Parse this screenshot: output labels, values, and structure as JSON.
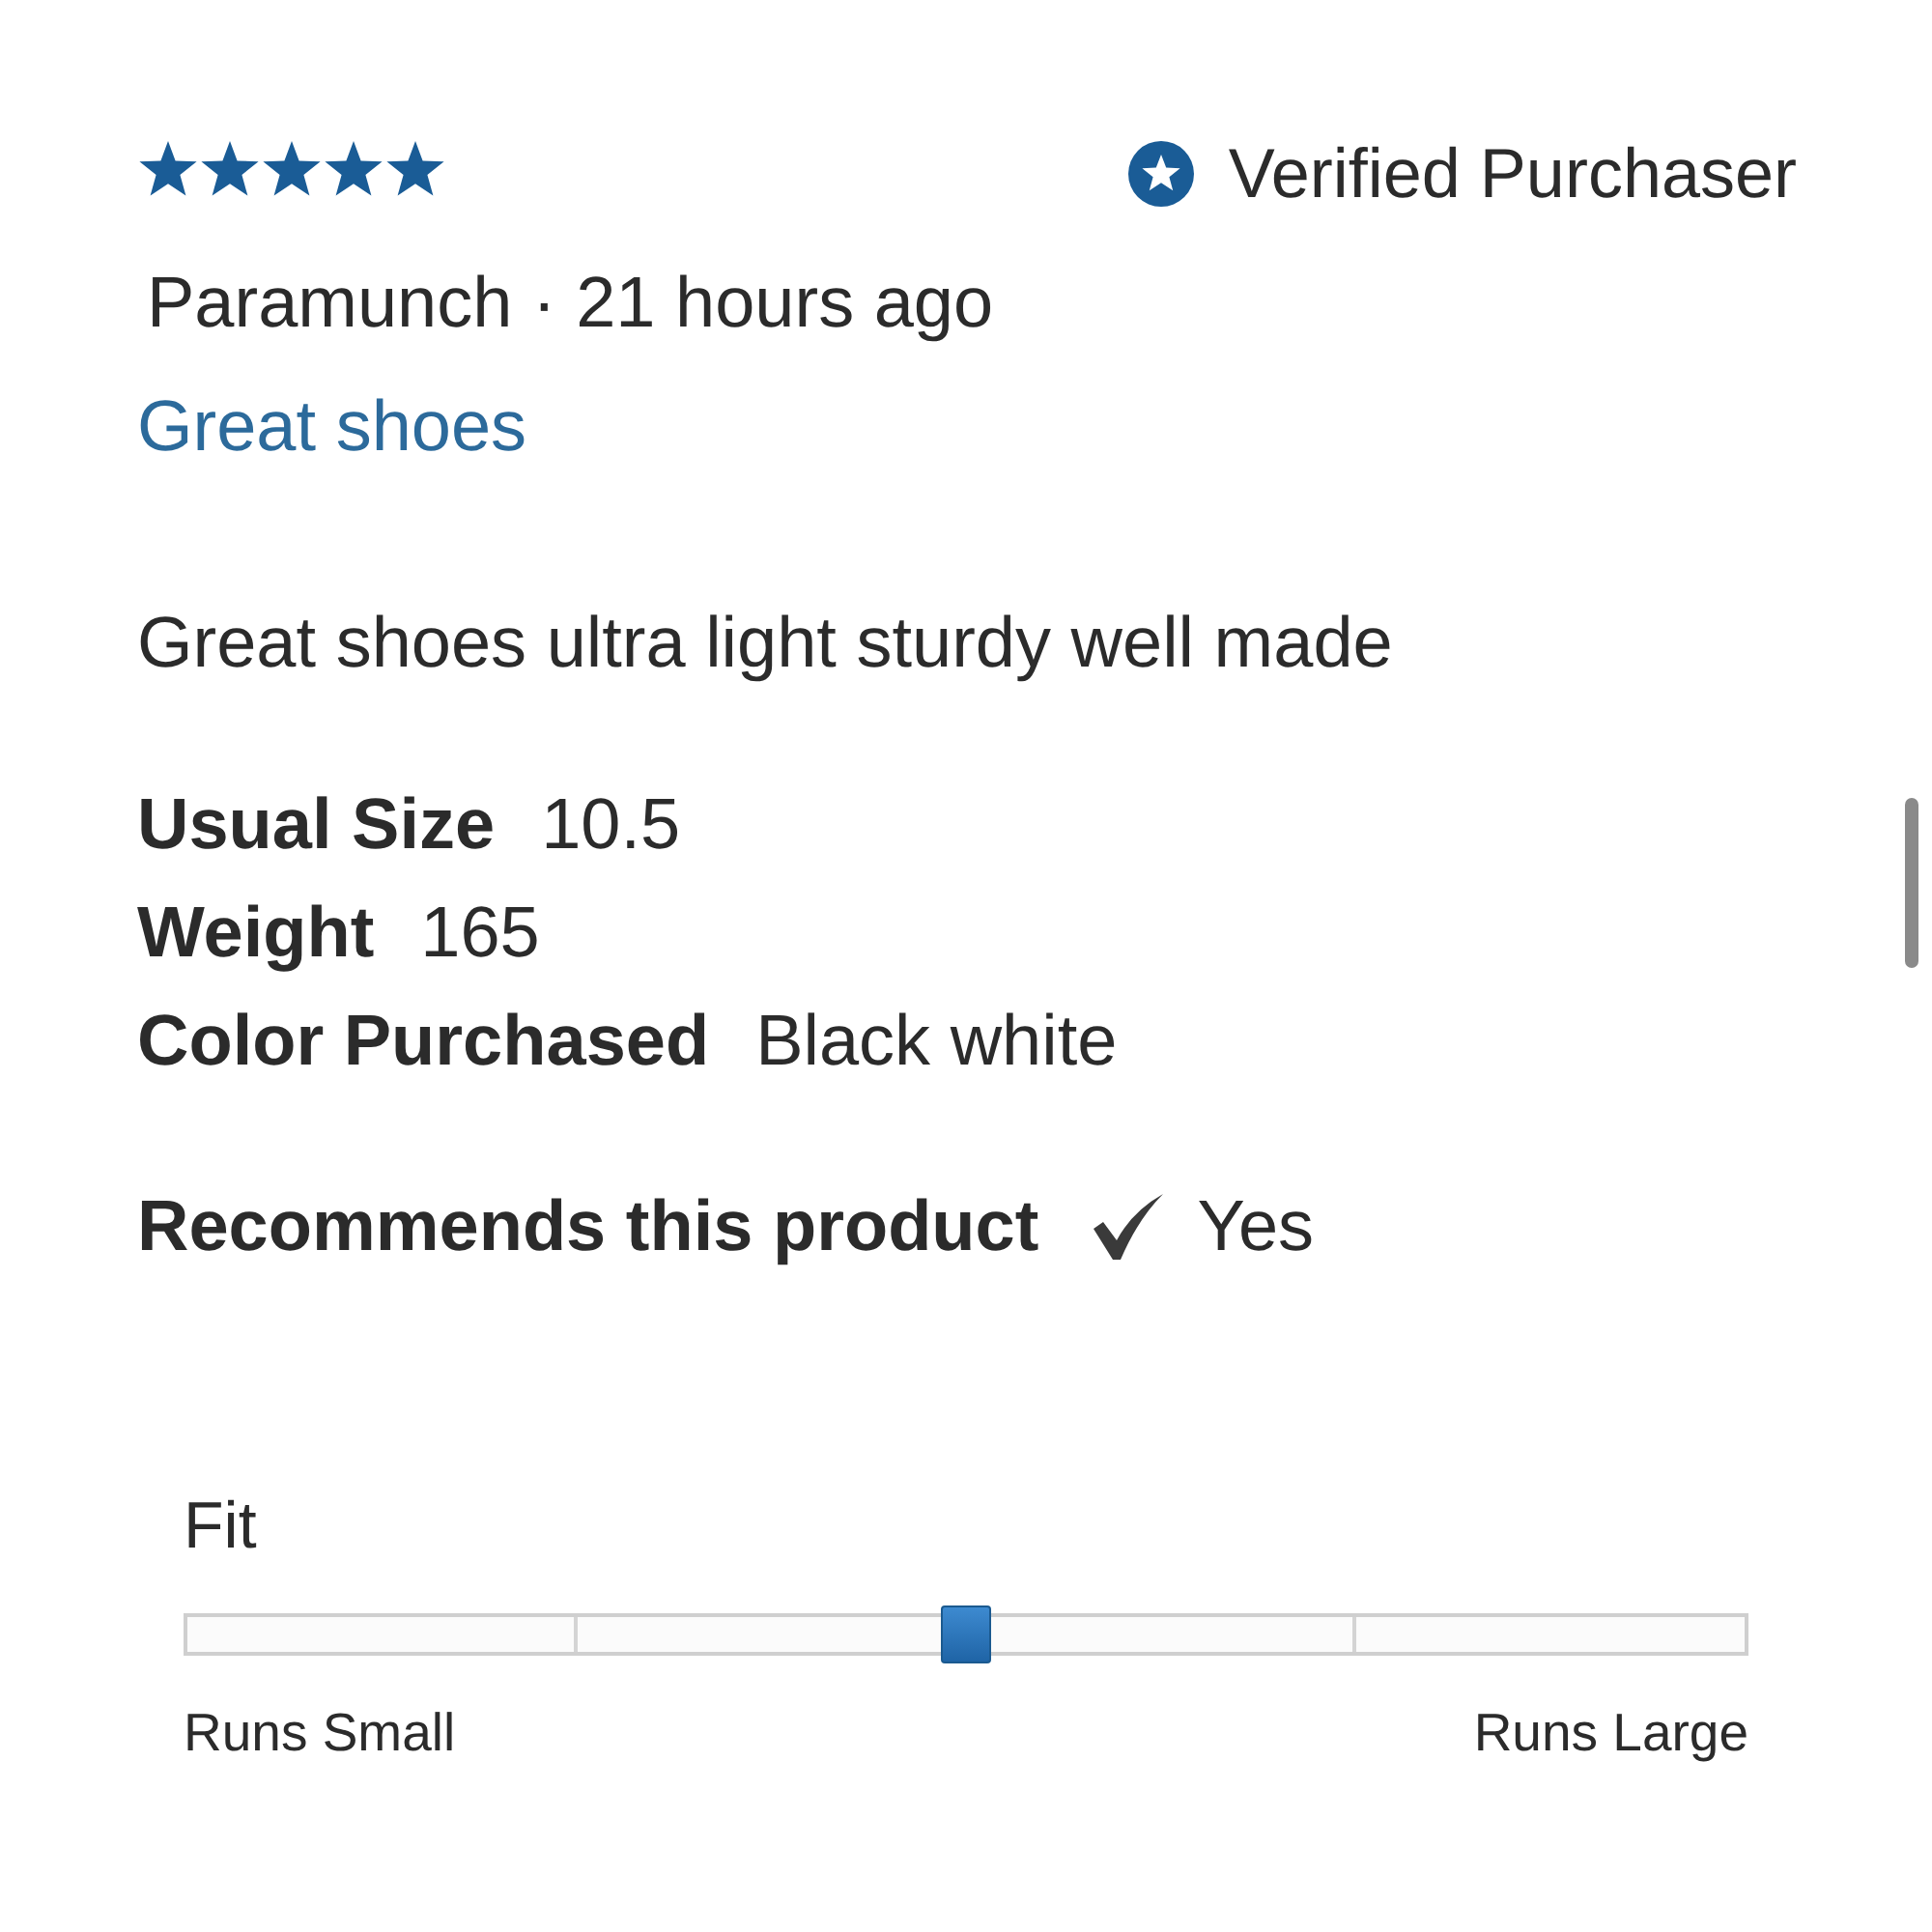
{
  "review": {
    "stars": 5,
    "verified_label": "Verified Purchaser",
    "byline": "Paramunch · 21 hours ago",
    "title": "Great shoes",
    "body": "Great shoes ultra light sturdy well made"
  },
  "details": [
    {
      "label": "Usual Size",
      "value": "10.5"
    },
    {
      "label": "Weight",
      "value": "165"
    },
    {
      "label": "Color Purchased",
      "value": "Black white"
    }
  ],
  "recommendation": {
    "label": "Recommends this product",
    "recommended": true,
    "answer": "Yes"
  },
  "fit": {
    "label": "Fit",
    "level": 0.5,
    "min_label": "Runs Small",
    "max_label": "Runs Large"
  }
}
